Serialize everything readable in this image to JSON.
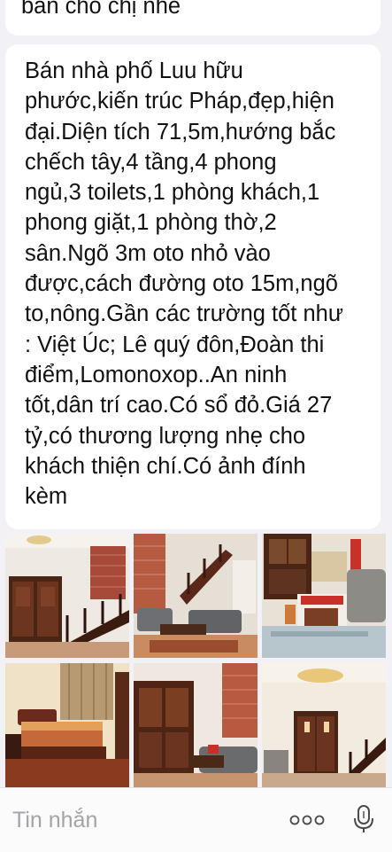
{
  "messages": {
    "previous_fragment": "bán cho chị nhé",
    "listing_text": "Bán nhà phố Lưu hữu phước,kiến trúc Pháp,đẹp,hiện đại.Diện tích 71,5m,hướng bắc chếch tây,4 tầng,4 phong ngủ,3 toilets,1 phòng khách,1 phong giặt,1 phòng thờ,2 sân.Ngõ 3m oto nhỏ vào được,cách đường oto 15m,ngõ to,nông.Gần các trường tốt như : Việt Úc; Lê quý đôn,Đoàn thi điểm,Lomonoxop..An ninh tốt,dân trí cao.Có sổ đỏ.Giá 27 tỷ,có thương lượng nhẹ cho khách thiện chí.Có ảnh đính kèm",
    "listing_lines": [
      "Bán nhà phố Luu hữu",
      "phước,kiến trúc Pháp,đẹp,hiện",
      "đại.Diện tích 71,5m,hướng bắc",
      "chếch tây,4 tầng,4 phong",
      "ngủ,3 toilets,1 phòng khách,1",
      "phong giặt,1 phòng thờ,2",
      "sân.Ngõ 3m oto nhỏ vào",
      "được,cách đường oto 15m,ngõ",
      "to,nông.Gần các trường tốt như",
      ": Việt Úc; Lê quý đôn,Đoàn thi",
      "điểm,Lomonoxop..An ninh",
      "tốt,dân trí cao.Có sổ đỏ.Giá 27",
      "tỷ,có thương lượng nhẹ cho",
      "khách thiện chí.Có ảnh đính",
      "kèm"
    ]
  },
  "photos": [
    {
      "subject": "entrance-hall-staircase"
    },
    {
      "subject": "living-room-staircase"
    },
    {
      "subject": "sofa-table-gift-box"
    },
    {
      "subject": "bedroom"
    },
    {
      "subject": "wooden-door-sofa"
    },
    {
      "subject": "hallway-chandelier"
    }
  ],
  "input_bar": {
    "placeholder": "Tin nhắn",
    "more_icon": "ellipsis-icon",
    "mic_icon": "microphone-icon"
  },
  "colors": {
    "background": "#f2f2f6",
    "bubble": "#ffffff",
    "text": "#111111",
    "placeholder": "#a3a3a8"
  }
}
